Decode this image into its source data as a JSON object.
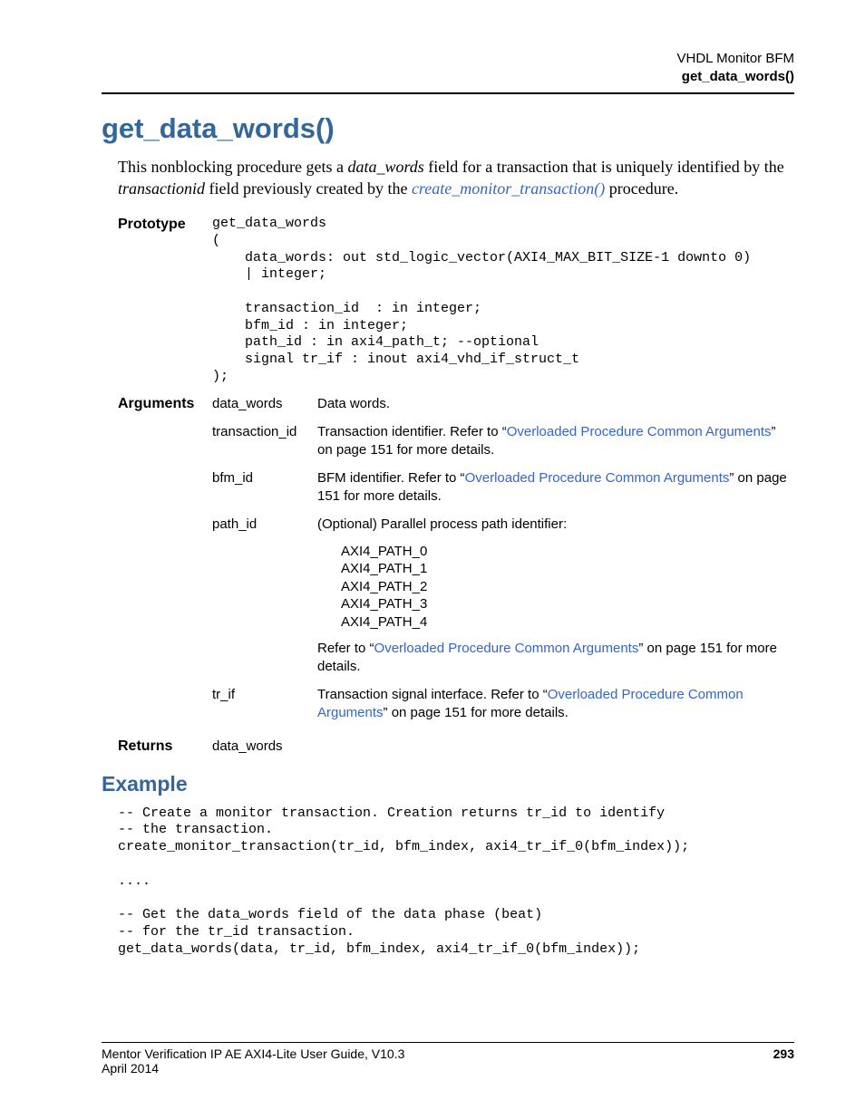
{
  "header": {
    "line1": "VHDL Monitor BFM",
    "line2": "get_data_words()"
  },
  "title": "get_data_words()",
  "intro": {
    "pre": "This nonblocking procedure gets a ",
    "em1": "data_words",
    "mid1": " field for a transaction that is uniquely identified by the ",
    "em2": "transactionid",
    "mid2": " field previously created by the ",
    "link": "create_monitor_transaction()",
    "post": " procedure."
  },
  "labels": {
    "prototype": "Prototype",
    "arguments": "Arguments",
    "returns": "Returns"
  },
  "prototype_code": "get_data_words\n(\n    data_words: out std_logic_vector(AXI4_MAX_BIT_SIZE-1 downto 0)\n    | integer;\n\n    transaction_id  : in integer;\n    bfm_id : in integer;\n    path_id : in axi4_path_t; --optional\n    signal tr_if : inout axi4_vhd_if_struct_t\n);",
  "args": {
    "data_words": {
      "name": "data_words",
      "desc": "Data words."
    },
    "transaction_id": {
      "name": "transaction_id",
      "pre": "Transaction identifier. Refer to “",
      "link": "Overloaded Procedure Common Arguments",
      "post": "” on page 151 for more details."
    },
    "bfm_id": {
      "name": "bfm_id",
      "pre": "BFM identifier. Refer to “",
      "link": "Overloaded Procedure Common Arguments",
      "post": "” on page 151 for more details."
    },
    "path_id": {
      "name": "path_id",
      "desc": "(Optional) Parallel process path identifier:",
      "paths": "AXI4_PATH_0\nAXI4_PATH_1\nAXI4_PATH_2\nAXI4_PATH_3\nAXI4_PATH_4",
      "ref_pre": "Refer to “",
      "ref_link": "Overloaded Procedure Common Arguments",
      "ref_post": "” on page 151 for more details."
    },
    "tr_if": {
      "name": "tr_if",
      "pre": "Transaction signal interface. Refer to “",
      "link": "Overloaded Procedure Common Arguments",
      "post": "” on page 151 for more details."
    }
  },
  "returns_value": "data_words",
  "example_heading": "Example",
  "example_code": "-- Create a monitor transaction. Creation returns tr_id to identify\n-- the transaction.\ncreate_monitor_transaction(tr_id, bfm_index, axi4_tr_if_0(bfm_index));\n\n....\n\n-- Get the data_words field of the data phase (beat)\n-- for the tr_id transaction.\nget_data_words(data, tr_id, bfm_index, axi4_tr_if_0(bfm_index));",
  "footer": {
    "guide": "Mentor Verification IP AE AXI4-Lite User Guide, V10.3",
    "page": "293",
    "date": "April 2014"
  }
}
